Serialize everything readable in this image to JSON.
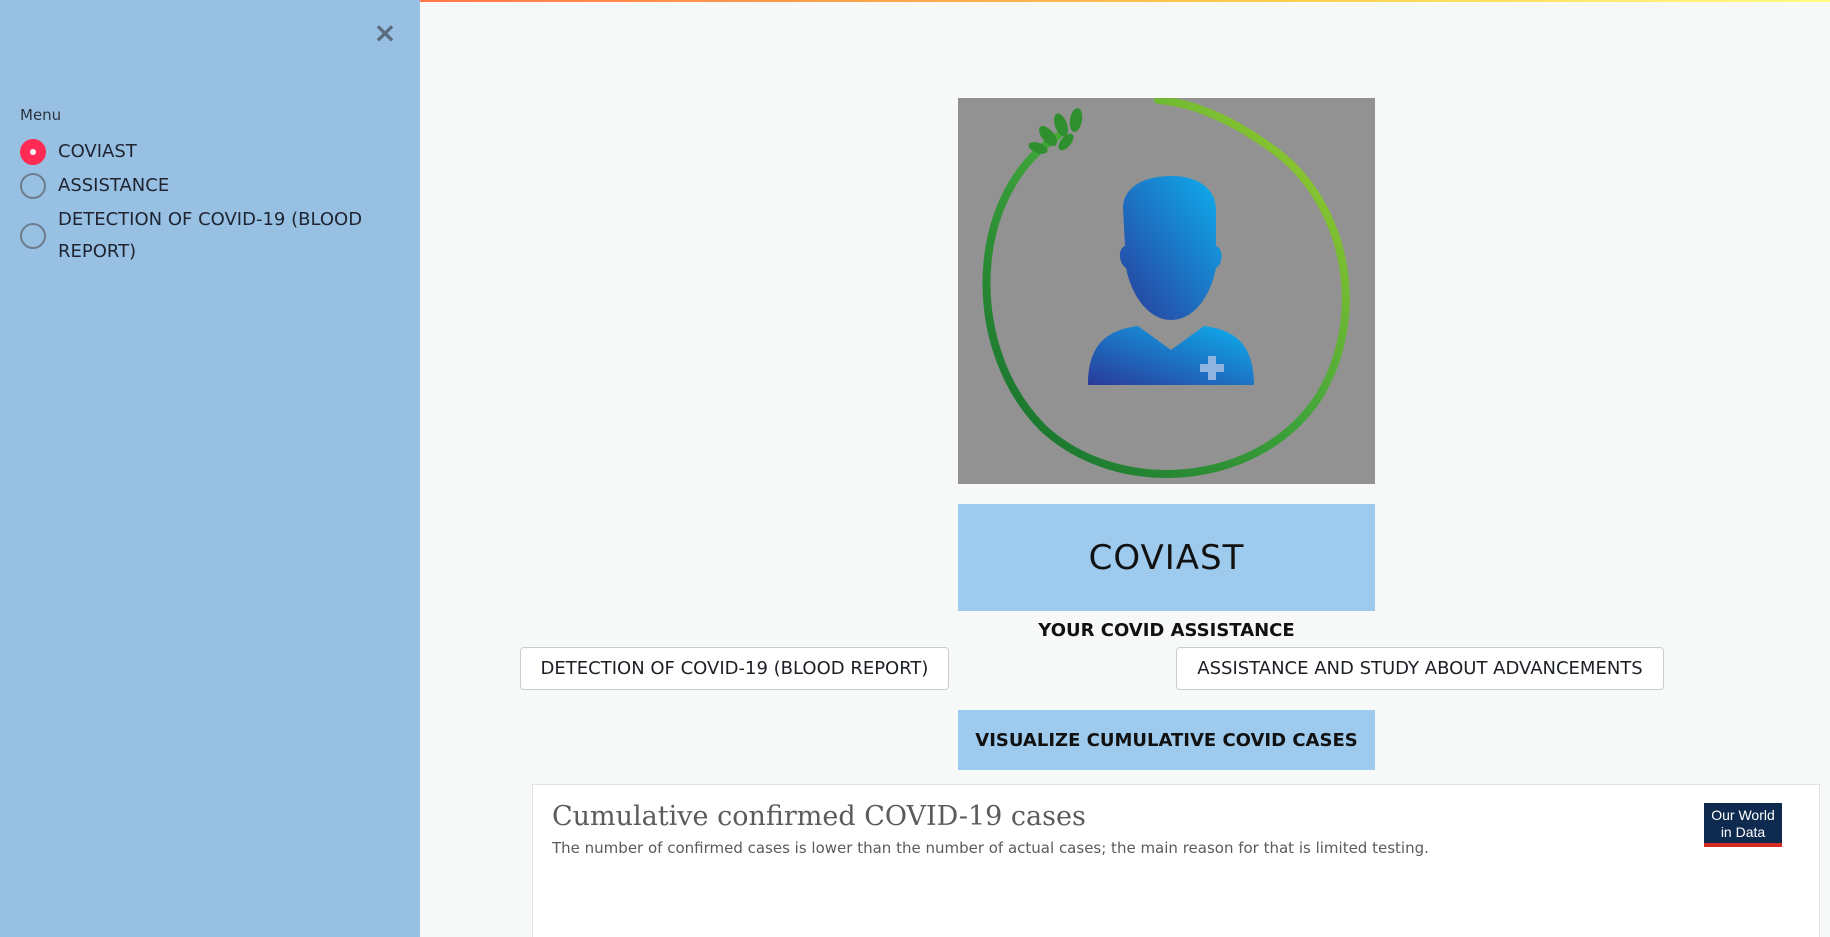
{
  "sidebar": {
    "close_icon": "close-icon",
    "menu_label": "Menu",
    "items": [
      {
        "label": "COVIAST",
        "selected": true
      },
      {
        "label": "ASSISTANCE",
        "selected": false
      },
      {
        "label": "DETECTION OF COVID-19 (BLOOD REPORT)",
        "selected": false
      }
    ]
  },
  "main": {
    "logo_icon": "doctor-avatar-icon",
    "title": "COVIAST",
    "subtitle": "YOUR COVID ASSISTANCE",
    "buttons": {
      "detection": "DETECTION OF COVID-19 (BLOOD REPORT)",
      "assistance": "ASSISTANCE AND STUDY ABOUT ADVANCEMENTS"
    },
    "visualize_label": "VISUALIZE CUMULATIVE COVID CASES",
    "card": {
      "title": "Cumulative confirmed COVID-19 cases",
      "subtitle": "The number of confirmed cases is lower than the number of actual cases; the main reason for that is limited testing.",
      "logo_line1": "Our World",
      "logo_line2": "in Data"
    }
  },
  "colors": {
    "sidebar_bg": "#97c0e3",
    "accent_box": "#9dcaed",
    "radio_selected": "#ff2b54",
    "main_bg": "#f7f8f8"
  }
}
